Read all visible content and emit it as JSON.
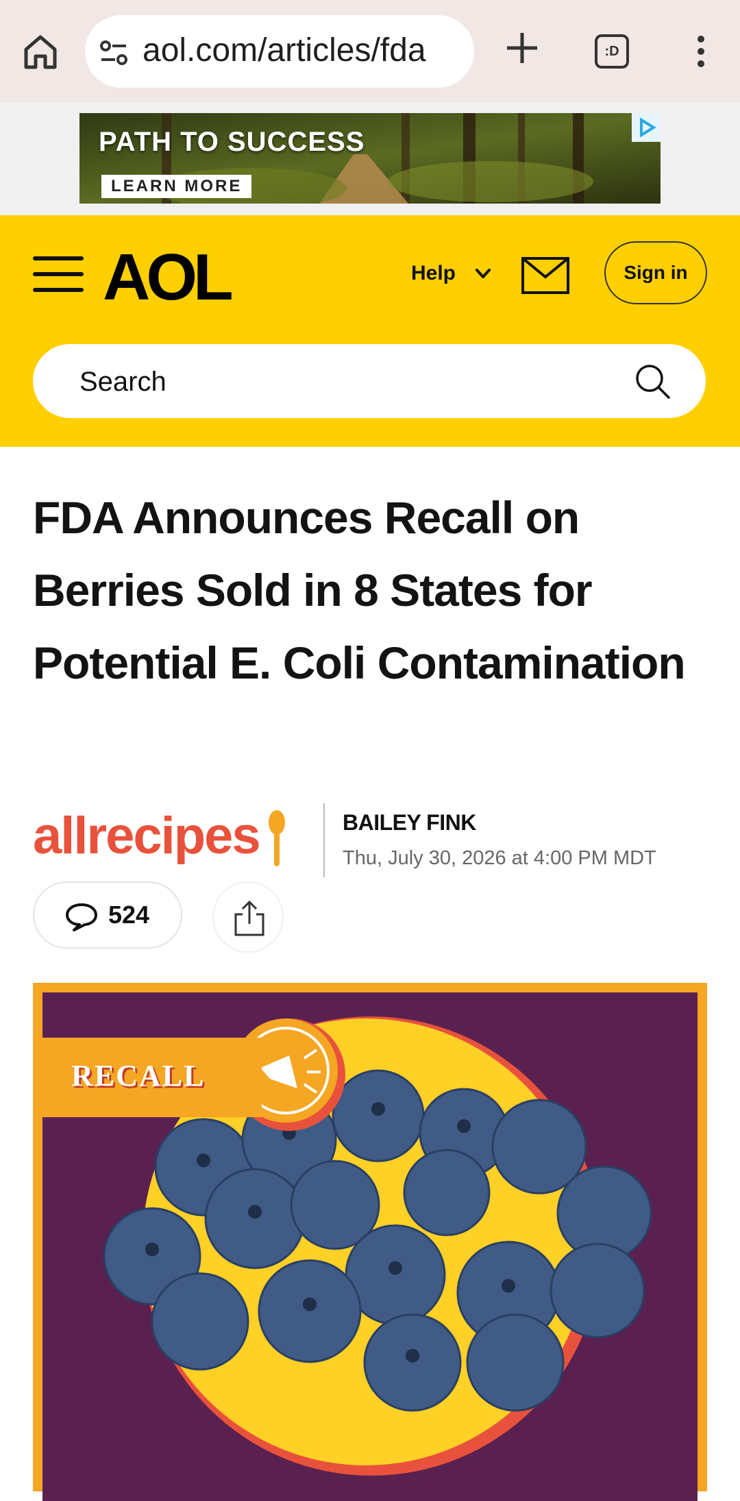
{
  "browser": {
    "url": "aol.com/articles/fda",
    "tab_icon_text": ":D"
  },
  "ad": {
    "headline": "PATH TO SUCCESS",
    "cta": "LEARN MORE"
  },
  "header": {
    "logo": "AOL",
    "help_label": "Help",
    "sign_in_label": "Sign in",
    "search_placeholder": "Search",
    "brand_color": "#ffcf00"
  },
  "article": {
    "title": "FDA Announces Recall on Berries Sold in 8 States for Potential E. Coli Contamination",
    "source": "allrecipes",
    "author": "BAILEY FINK",
    "date": "Thu, July 30, 2026 at 4:00 PM MDT",
    "comment_count": "524",
    "hero_badge": "RECALL"
  },
  "colors": {
    "accent": "#ffcf00",
    "source_brand": "#e8523c",
    "hero_background": "#5a2150",
    "hero_border": "#f5a623"
  }
}
